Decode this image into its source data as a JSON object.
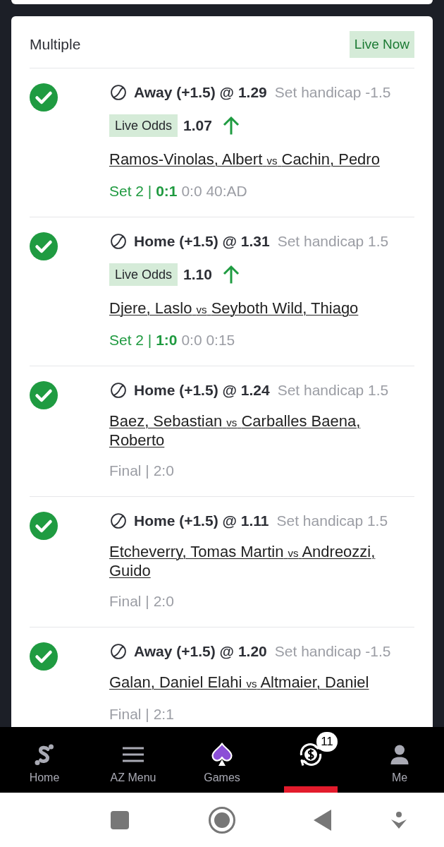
{
  "bet_card": {
    "title": "Multiple",
    "status": "Live Now",
    "legs": [
      {
        "won": true,
        "selection": "Away (+1.5) @ 1.29",
        "market": "Set handicap -1.5",
        "live_odds": {
          "label": "Live Odds",
          "value": "1.07",
          "rising": true
        },
        "home": "Ramos-Vinolas, Albert",
        "vs": "vs",
        "away": "Cachin, Pedro",
        "score": {
          "live": true,
          "status": "Set 2 |",
          "sets": "0:1",
          "points": "0:0 40:AD"
        }
      },
      {
        "won": true,
        "selection": "Home (+1.5) @ 1.31",
        "market": "Set handicap 1.5",
        "live_odds": {
          "label": "Live Odds",
          "value": "1.10",
          "rising": true
        },
        "home": "Djere, Laslo",
        "vs": "vs",
        "away": "Seyboth Wild, Thiago",
        "score": {
          "live": true,
          "status": "Set 2 |",
          "sets": "1:0",
          "points": "0:0 0:15"
        }
      },
      {
        "won": true,
        "selection": "Home (+1.5) @ 1.24",
        "market": "Set handicap 1.5",
        "home": "Baez, Sebastian",
        "vs": "vs",
        "away": "Carballes Baena, Roberto",
        "score": {
          "live": false,
          "status": "Final |",
          "sets": "2:0"
        }
      },
      {
        "won": true,
        "selection": "Home (+1.5) @ 1.11",
        "market": "Set handicap 1.5",
        "home": "Etcheverry, Tomas Martin",
        "vs": "vs",
        "away": "Andreozzi, Guido",
        "score": {
          "live": false,
          "status": "Final |",
          "sets": "2:0"
        }
      },
      {
        "won": true,
        "selection": "Away (+1.5) @ 1.20",
        "market": "Set handicap -1.5",
        "home": "Galan, Daniel Elahi",
        "vs": "vs",
        "away": "Altmaier, Daniel",
        "score": {
          "live": false,
          "status": "Final |",
          "sets": "2:1"
        }
      }
    ]
  },
  "bottom_nav": [
    {
      "label": "Home",
      "selected": false
    },
    {
      "label": "AZ Menu",
      "selected": false
    },
    {
      "label": "Games",
      "selected": false
    },
    {
      "badge": "11",
      "selected": true
    },
    {
      "label": "Me",
      "selected": false
    }
  ]
}
